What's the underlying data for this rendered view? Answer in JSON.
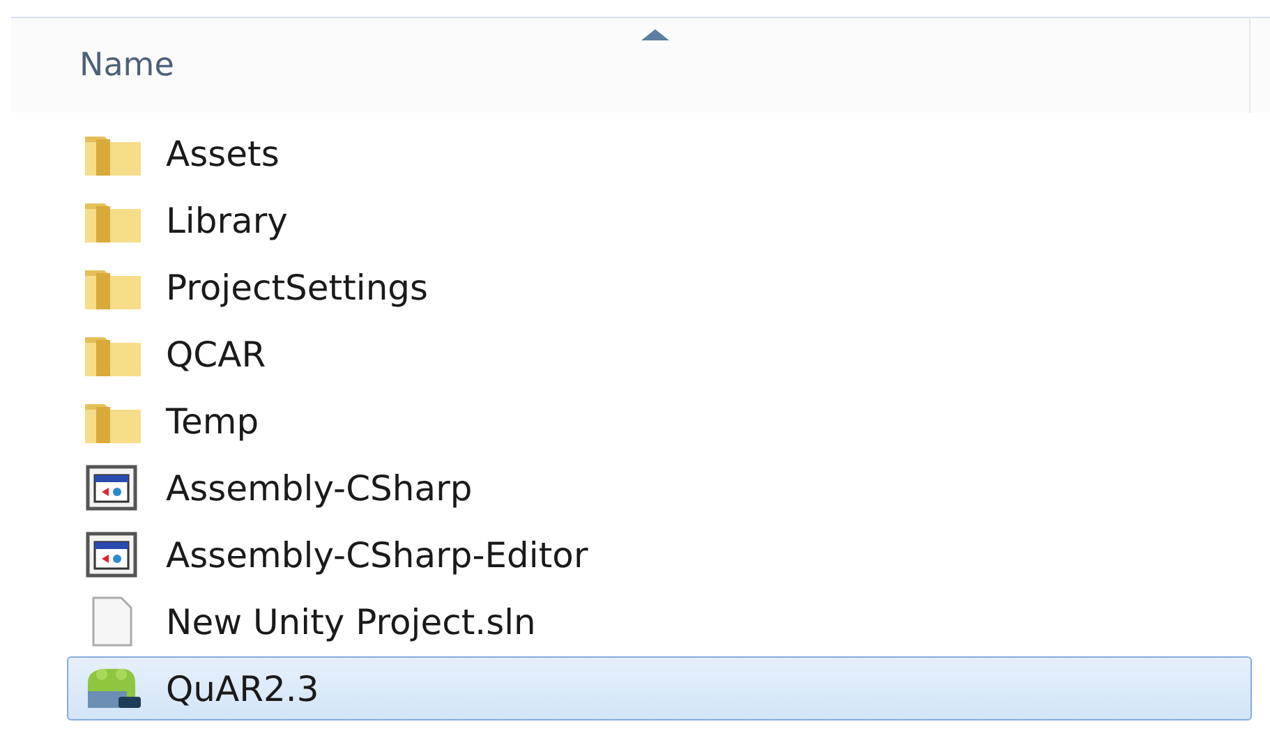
{
  "column_header": {
    "label": "Name",
    "sorted_ascending": true
  },
  "items": [
    {
      "name": "Assets",
      "kind": "folder",
      "selected": false
    },
    {
      "name": "Library",
      "kind": "folder",
      "selected": false
    },
    {
      "name": "ProjectSettings",
      "kind": "folder",
      "selected": false
    },
    {
      "name": "QCAR",
      "kind": "folder",
      "selected": false
    },
    {
      "name": "Temp",
      "kind": "folder",
      "selected": false
    },
    {
      "name": "Assembly-CSharp",
      "kind": "project",
      "selected": false
    },
    {
      "name": "Assembly-CSharp-Editor",
      "kind": "project",
      "selected": false
    },
    {
      "name": "New Unity Project.sln",
      "kind": "file",
      "selected": false
    },
    {
      "name": "QuAR2.3",
      "kind": "app",
      "selected": true
    }
  ]
}
